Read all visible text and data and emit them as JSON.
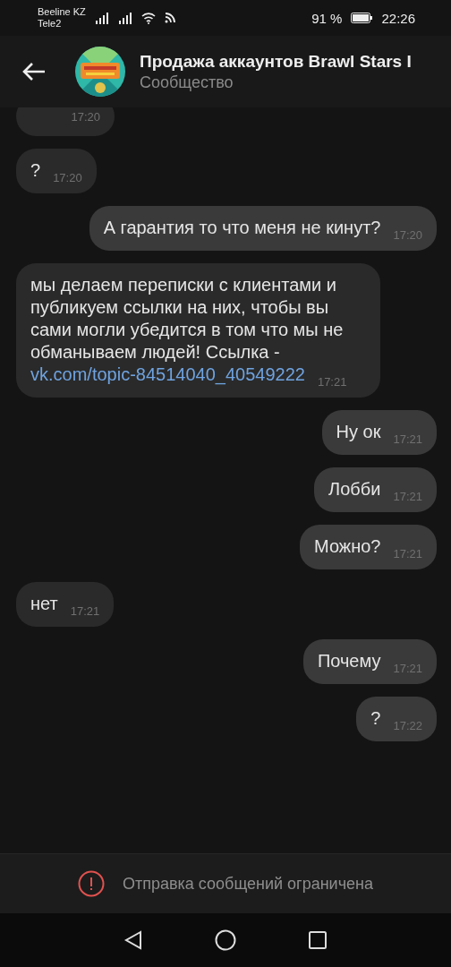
{
  "status_bar": {
    "carriers": [
      "Beeline KZ",
      "Tele2"
    ],
    "battery": "91 %",
    "time": "22:26"
  },
  "header": {
    "title": "Продажа аккаунтов Brawl Stars I",
    "subtitle": "Сообщество"
  },
  "messages": [
    {
      "outgoing": false,
      "time": "17:20",
      "kind": "cut"
    },
    {
      "outgoing": false,
      "text": "?",
      "time": "17:20"
    },
    {
      "outgoing": true,
      "text": "А гарантия то что меня не кинут?",
      "time": "17:20"
    },
    {
      "outgoing": false,
      "text": "мы делаем переписки с клиентами и публикуем ссылки на них, чтобы вы сами могли убедится в том что мы не обманываем людей! Ссылка -",
      "link": "vk.com/topic-84514040_40549222",
      "time": "17:21"
    },
    {
      "outgoing": true,
      "text": "Ну ок",
      "time": "17:21"
    },
    {
      "outgoing": true,
      "text": "Лобби",
      "time": "17:21"
    },
    {
      "outgoing": true,
      "text": "Можно?",
      "time": "17:21"
    },
    {
      "outgoing": false,
      "text": "нет",
      "time": "17:21"
    },
    {
      "outgoing": true,
      "text": "Почему",
      "time": "17:21"
    },
    {
      "outgoing": true,
      "text": "?",
      "time": "17:22"
    }
  ],
  "notice": "Отправка сообщений ограничена"
}
